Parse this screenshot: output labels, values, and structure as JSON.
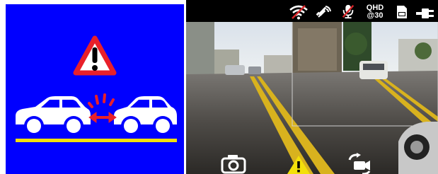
{
  "status_bar": {
    "wifi": "wifi-off-icon",
    "gps": "gps-signal-icon",
    "mic": "microphone-muted-icon",
    "resolution_label": "QHD",
    "fps_label": "@30",
    "sd_card": "sd-card-icon",
    "power": "power-plug-icon"
  },
  "illustration": {
    "warning": "warning-triangle-icon",
    "scene": "front-collision-warning-illustration"
  },
  "toolbar": {
    "snapshot": "camera-snapshot-icon",
    "emergency": "emergency-warning-icon",
    "switch_camera": "switch-camera-icon"
  },
  "colors": {
    "panel_bg": "#0000ff",
    "warning_red": "#e8202a",
    "lane_yellow": "#f3e00a",
    "mic_red": "#d9262a"
  }
}
